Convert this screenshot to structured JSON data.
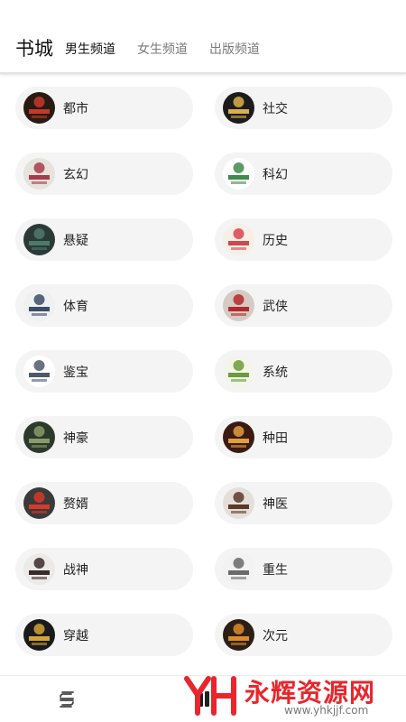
{
  "header": {
    "title": "书城",
    "tabs": [
      {
        "label": "男生频道",
        "active": true
      },
      {
        "label": "女生频道",
        "active": false
      },
      {
        "label": "出版频道",
        "active": false
      }
    ]
  },
  "categories": [
    {
      "label": "都市",
      "cover": [
        "#2a1a14",
        "#c43a2a"
      ]
    },
    {
      "label": "社交",
      "cover": [
        "#1c1c1c",
        "#d9b04a"
      ]
    },
    {
      "label": "玄幻",
      "cover": [
        "#e6e2dc",
        "#a63c4a"
      ]
    },
    {
      "label": "科幻",
      "cover": [
        "#ffffff",
        "#3f8a4a"
      ]
    },
    {
      "label": "悬疑",
      "cover": [
        "#2a3a36",
        "#4f7a6a"
      ]
    },
    {
      "label": "历史",
      "cover": [
        "#f6efe6",
        "#d7434f"
      ]
    },
    {
      "label": "体育",
      "cover": [
        "#eef0f1",
        "#3a4d66"
      ]
    },
    {
      "label": "武侠",
      "cover": [
        "#d6cac4",
        "#b22a2a"
      ]
    },
    {
      "label": "鉴宝",
      "cover": [
        "#ffffff",
        "#4d5a6a"
      ]
    },
    {
      "label": "系统",
      "cover": [
        "#f3f5ea",
        "#6b9b3a"
      ]
    },
    {
      "label": "神豪",
      "cover": [
        "#2c3a2c",
        "#8a9a6a"
      ]
    },
    {
      "label": "种田",
      "cover": [
        "#3a1a12",
        "#e0a040"
      ]
    },
    {
      "label": "赘婿",
      "cover": [
        "#3a3a3a",
        "#d63a2a"
      ]
    },
    {
      "label": "神医",
      "cover": [
        "#e4dfd9",
        "#5a3a2a"
      ]
    },
    {
      "label": "战神",
      "cover": [
        "#eceae8",
        "#3a2a2a"
      ]
    },
    {
      "label": "重生",
      "cover": [
        "#f2f2f2",
        "#6a6a6a"
      ]
    },
    {
      "label": "穿越",
      "cover": [
        "#1a1a1a",
        "#d4a23a"
      ]
    },
    {
      "label": "次元",
      "cover": [
        "#2a2016",
        "#e08a2a"
      ]
    }
  ],
  "bottom_nav": {
    "icons": [
      "bookshelf-icon",
      "bookstore-icon"
    ]
  },
  "watermark": {
    "brand": "永辉资源网",
    "url": "www.yhkjjf.com",
    "color": "#e8262d"
  },
  "colors": {
    "pill_bg": "#f4f4f4",
    "active_tab": "#111111",
    "inactive_tab": "#7a7a7a"
  }
}
